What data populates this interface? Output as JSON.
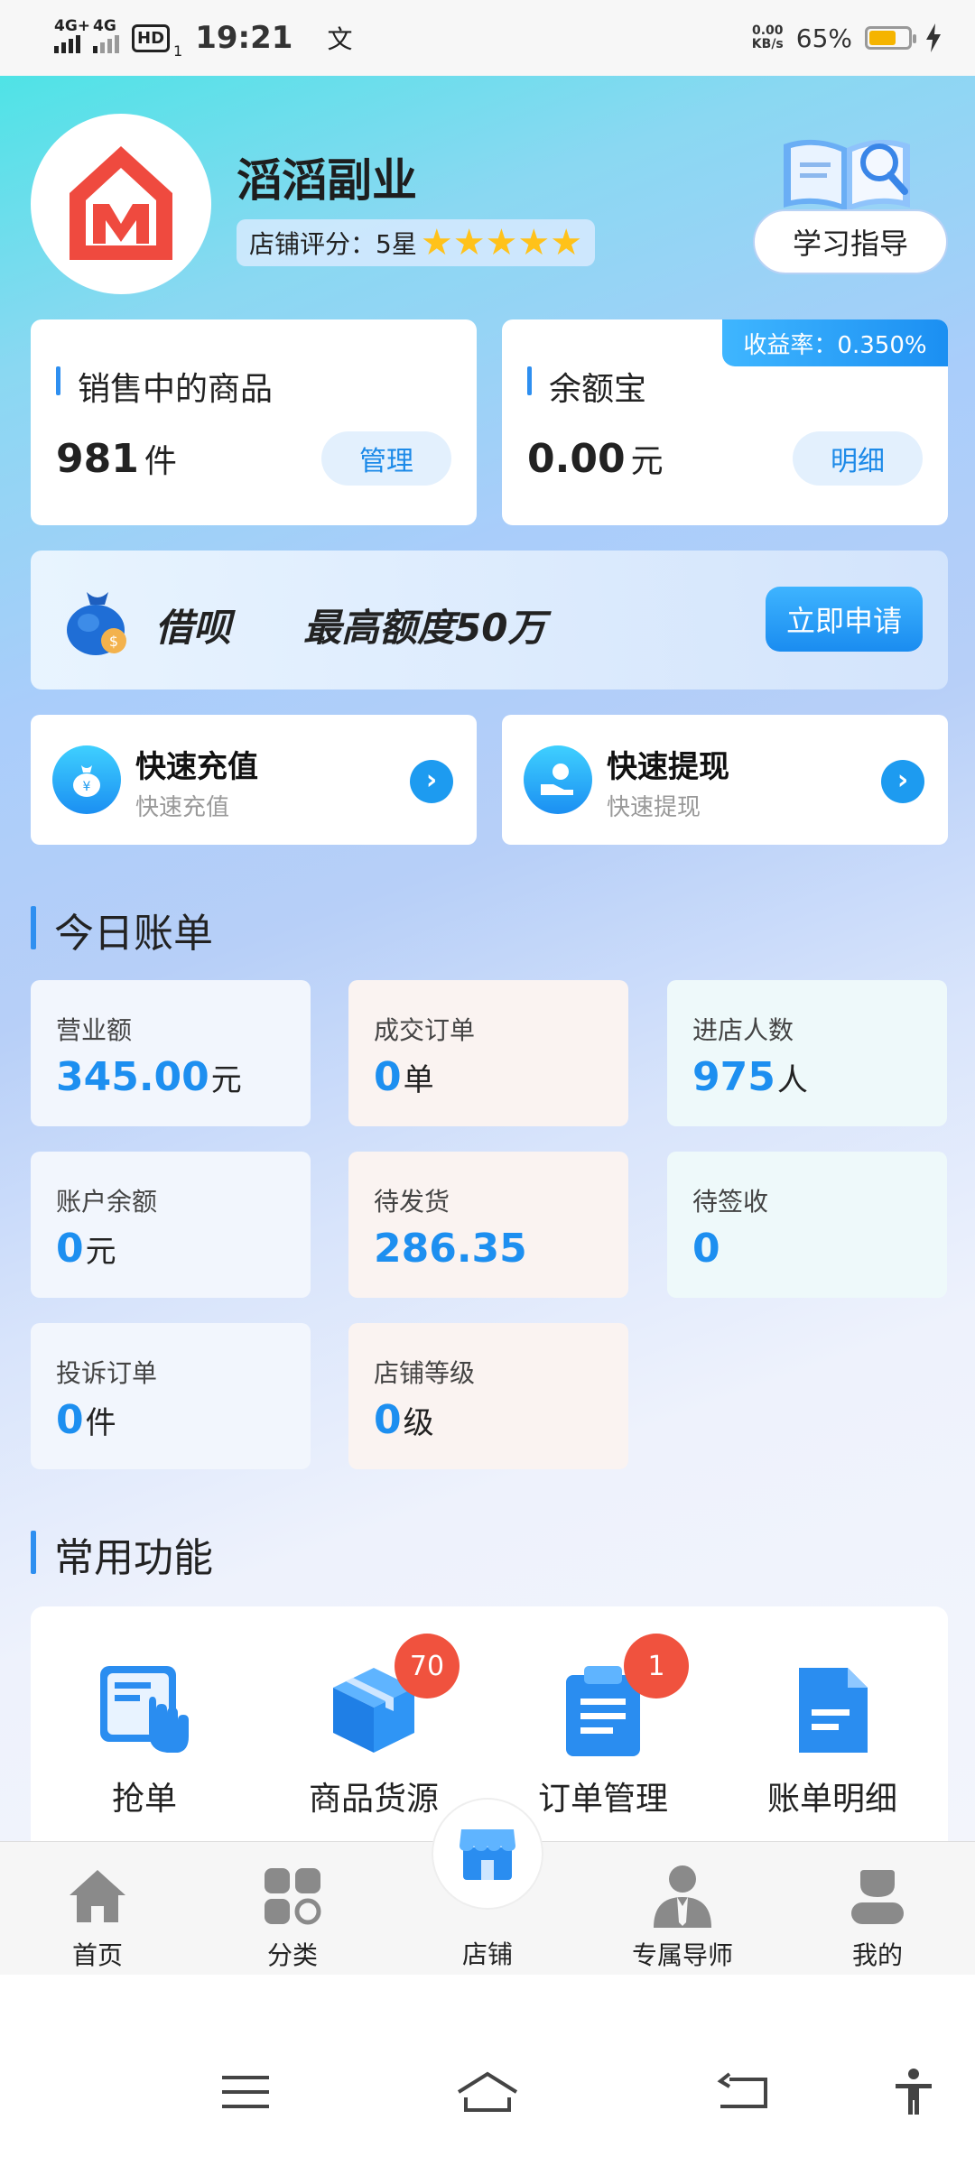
{
  "status_bar": {
    "network1": "4G+",
    "network2": "4G",
    "hd": "HD",
    "hd_sub": "1",
    "time": "19:21",
    "extra_icon": "文",
    "speed_value": "0.00",
    "speed_unit": "KB/s",
    "battery_percent": "65%",
    "battery_level": 0.65,
    "battery_color": "#f5b400"
  },
  "header": {
    "shop_name": "滔滔副业",
    "rating_text": "店铺评分：5星",
    "rating_stars": 5,
    "guide_button": "学习指导",
    "logo_icon": "shop-house-m-logo",
    "guide_icon": "open-book-magnifier-icon"
  },
  "cards": {
    "selling": {
      "title": "销售中的商品",
      "value": "981",
      "unit": "件",
      "button": "管理"
    },
    "yuebao": {
      "title": "余额宝",
      "value": "0.00",
      "unit": "元",
      "button": "明细",
      "rate_tag": "收益率：0.350%"
    }
  },
  "loan": {
    "name": "借呗",
    "desc": "最高额度50万",
    "button": "立即申请",
    "icon": "money-bag-icon"
  },
  "quick_actions": [
    {
      "title": "快速充值",
      "subtitle": "快速充值",
      "icon": "money-bag-icon"
    },
    {
      "title": "快速提现",
      "subtitle": "快速提现",
      "icon": "hand-coin-icon"
    }
  ],
  "today_bill": {
    "title": "今日账单",
    "stats": [
      {
        "label": "营业额",
        "value": "345.00",
        "unit": "元"
      },
      {
        "label": "成交订单",
        "value": "0",
        "unit": "单"
      },
      {
        "label": "进店人数",
        "value": "975",
        "unit": "人"
      },
      {
        "label": "账户余额",
        "value": "0",
        "unit": "元"
      },
      {
        "label": "待发货",
        "value": "286.35",
        "unit": ""
      },
      {
        "label": "待签收",
        "value": "0",
        "unit": ""
      },
      {
        "label": "投诉订单",
        "value": "0",
        "unit": "件"
      },
      {
        "label": "店铺等级",
        "value": "0",
        "unit": "级"
      }
    ]
  },
  "common_functions": {
    "title": "常用功能",
    "items": [
      {
        "label": "抢单",
        "icon": "grab-order-icon",
        "badge": ""
      },
      {
        "label": "商品货源",
        "icon": "product-box-icon",
        "badge": "70"
      },
      {
        "label": "订单管理",
        "icon": "clipboard-list-icon",
        "badge": "1"
      },
      {
        "label": "账单明细",
        "icon": "document-icon",
        "badge": ""
      }
    ]
  },
  "bottom_nav": {
    "items": [
      {
        "label": "首页",
        "icon": "home-icon"
      },
      {
        "label": "分类",
        "icon": "category-grid-icon"
      },
      {
        "label": "店铺",
        "icon": "store-icon"
      },
      {
        "label": "专属导师",
        "icon": "mentor-icon"
      },
      {
        "label": "我的",
        "icon": "user-icon"
      }
    ]
  },
  "colors": {
    "accent": "#1d8ff0",
    "badge": "#f0523e",
    "logo_red": "#ef4a3f"
  }
}
